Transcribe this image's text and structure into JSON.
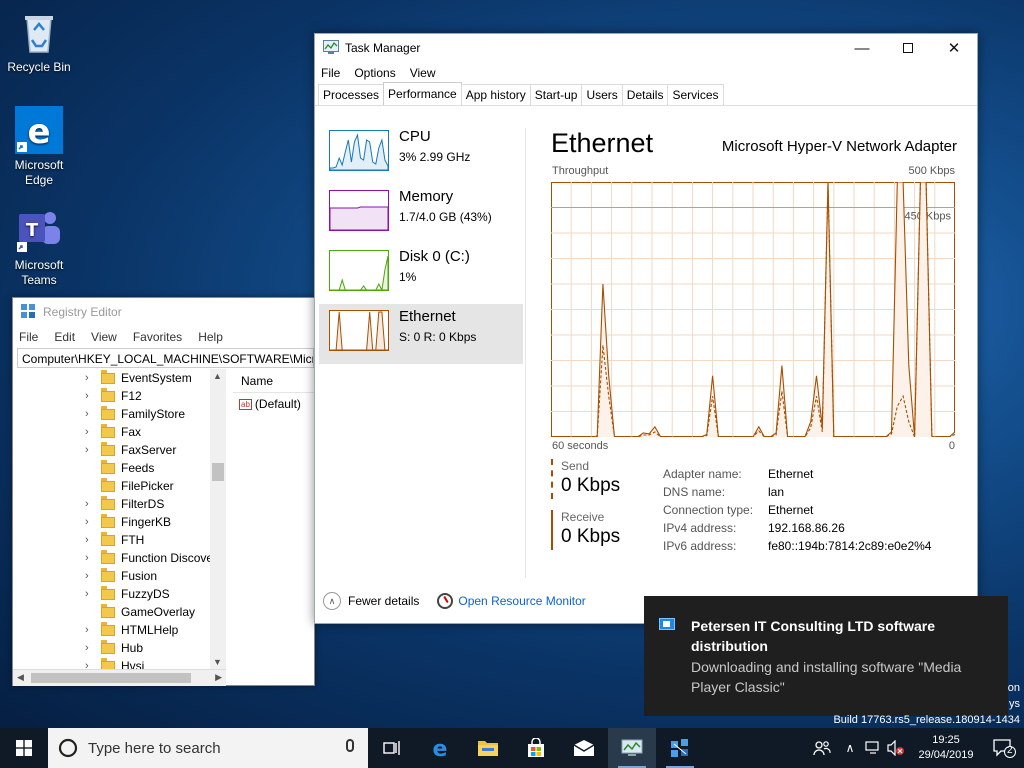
{
  "desktop": {
    "icons": [
      {
        "label": "Recycle Bin"
      },
      {
        "label": "Microsoft Edge"
      },
      {
        "label": "Microsoft Teams"
      }
    ]
  },
  "regedit": {
    "title": "Registry Editor",
    "menu": [
      "File",
      "Edit",
      "View",
      "Favorites",
      "Help"
    ],
    "address": "Computer\\HKEY_LOCAL_MACHINE\\SOFTWARE\\Micros",
    "tree_items": [
      {
        "label": "EventSystem",
        "has_children": true
      },
      {
        "label": "F12",
        "has_children": true
      },
      {
        "label": "FamilyStore",
        "has_children": true
      },
      {
        "label": "Fax",
        "has_children": true
      },
      {
        "label": "FaxServer",
        "has_children": true
      },
      {
        "label": "Feeds",
        "has_children": false
      },
      {
        "label": "FilePicker",
        "has_children": false
      },
      {
        "label": "FilterDS",
        "has_children": true
      },
      {
        "label": "FingerKB",
        "has_children": true
      },
      {
        "label": "FTH",
        "has_children": true
      },
      {
        "label": "Function Discove",
        "has_children": true
      },
      {
        "label": "Fusion",
        "has_children": true
      },
      {
        "label": "FuzzyDS",
        "has_children": true
      },
      {
        "label": "GameOverlay",
        "has_children": false
      },
      {
        "label": "HTMLHelp",
        "has_children": true
      },
      {
        "label": "Hub",
        "has_children": true
      },
      {
        "label": "Hvsi",
        "has_children": true
      }
    ],
    "values_header": "Name",
    "values": [
      {
        "name": "(Default)"
      }
    ]
  },
  "taskmgr": {
    "title": "Task Manager",
    "menu": [
      "File",
      "Options",
      "View"
    ],
    "tabs": [
      "Processes",
      "Performance",
      "App history",
      "Start-up",
      "Users",
      "Details",
      "Services"
    ],
    "active_tab": "Performance",
    "sidebar": [
      {
        "name": "CPU",
        "sub": "3% 2.99 GHz",
        "color": "#1779ba"
      },
      {
        "name": "Memory",
        "sub": "1.7/4.0 GB (43%)",
        "color": "#8b12ae"
      },
      {
        "name": "Disk 0 (C:)",
        "sub": "1%",
        "color": "#4da60c"
      },
      {
        "name": "Ethernet",
        "sub": "S: 0 R: 0 Kbps",
        "color": "#a74f01"
      }
    ],
    "selected": "Ethernet",
    "main": {
      "heading": "Ethernet",
      "adapter": "Microsoft Hyper-V Network Adapter",
      "throughput_label": "Throughput",
      "max_label": "500 Kbps",
      "mark_label": "450 Kbps",
      "time_left": "60 seconds",
      "time_right": "0",
      "send_label": "Send",
      "send_value": "0 Kbps",
      "receive_label": "Receive",
      "receive_value": "0 Kbps",
      "properties": [
        {
          "key": "Adapter name:",
          "value": "Ethernet"
        },
        {
          "key": "DNS name:",
          "value": "lan"
        },
        {
          "key": "Connection type:",
          "value": "Ethernet"
        },
        {
          "key": "IPv4 address:",
          "value": "192.168.86.26"
        },
        {
          "key": "IPv6 address:",
          "value": "fe80::194b:7814:2c89:e0e2%4"
        }
      ]
    },
    "footer": {
      "fewer": "Fewer details",
      "resmon": "Open Resource Monitor"
    }
  },
  "chart_data": {
    "type": "line",
    "title": "Throughput",
    "ylim": [
      0,
      500
    ],
    "x_range_label": [
      "60 seconds",
      "0"
    ],
    "series": [
      {
        "name": "Send",
        "style": "solid",
        "values": [
          0,
          0,
          0,
          0,
          0,
          0,
          0,
          0,
          2,
          300,
          120,
          0,
          0,
          0,
          0,
          0,
          8,
          6,
          20,
          0,
          0,
          0,
          0,
          0,
          0,
          0,
          0,
          5,
          120,
          0,
          0,
          0,
          0,
          0,
          0,
          0,
          20,
          0,
          0,
          8,
          140,
          0,
          0,
          0,
          0,
          30,
          120,
          20,
          500,
          0,
          0,
          0,
          0,
          0,
          0,
          0,
          0,
          0,
          0,
          10,
          500,
          500,
          140,
          0,
          500,
          500,
          0,
          0,
          0,
          0,
          10
        ]
      },
      {
        "name": "Receive",
        "style": "dashed",
        "values": [
          0,
          0,
          0,
          0,
          0,
          0,
          0,
          0,
          0,
          180,
          80,
          0,
          0,
          0,
          0,
          0,
          4,
          4,
          10,
          0,
          0,
          0,
          0,
          0,
          0,
          0,
          0,
          3,
          80,
          0,
          0,
          0,
          0,
          0,
          0,
          0,
          12,
          0,
          0,
          4,
          90,
          0,
          0,
          0,
          0,
          18,
          80,
          10,
          500,
          0,
          0,
          0,
          0,
          0,
          0,
          0,
          0,
          0,
          0,
          6,
          60,
          80,
          30,
          0,
          500,
          500,
          0,
          0,
          0,
          0,
          5
        ]
      }
    ],
    "mark_value": 450,
    "colors": {
      "line": "#a74f01",
      "grid": "#f1d9c3",
      "fill": "#fdf2ea"
    }
  },
  "toast": {
    "title": "Petersen IT Consulting LTD software distribution",
    "body": "Downloading and installing software \"Media Player Classic\""
  },
  "watermark": {
    "line1": "on",
    "line2": "ys",
    "line3": "Build 17763.rs5_release.180914-1434"
  },
  "taskbar": {
    "search_placeholder": "Type here to search",
    "time": "19:25",
    "date": "29/04/2019",
    "notif_count": "2"
  }
}
